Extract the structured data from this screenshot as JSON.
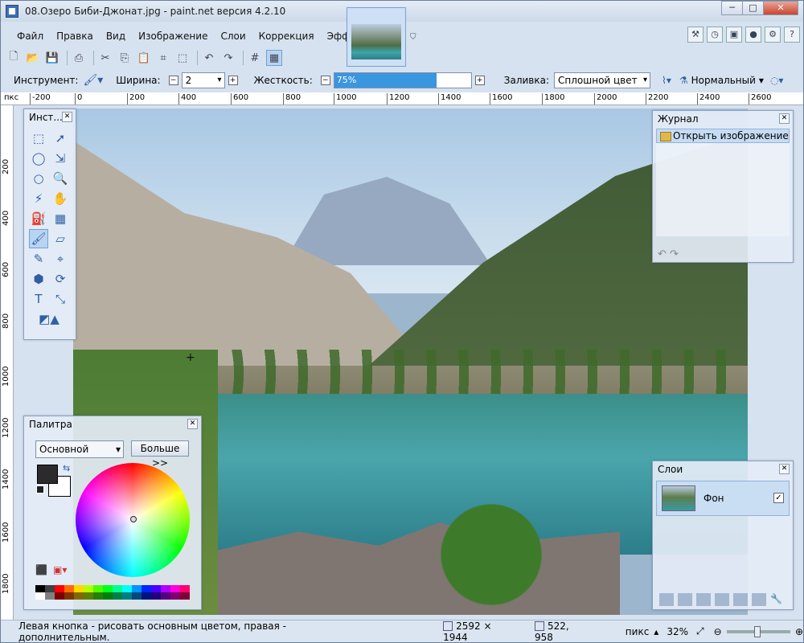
{
  "window": {
    "title": "08.Озеро Биби-Джонат.jpg - paint.net версия 4.2.10",
    "buttons": [
      "─",
      "□",
      "✕"
    ]
  },
  "menu": [
    "Файл",
    "Правка",
    "Вид",
    "Изображение",
    "Слои",
    "Коррекция",
    "Эффекты"
  ],
  "toolbar_icons": [
    "new-icon",
    "open-icon",
    "save-icon",
    "print-icon",
    "cut-icon",
    "copy-icon",
    "paste-icon",
    "crop-icon",
    "deselect-icon",
    "undo-icon",
    "redo-icon",
    "grid-icon",
    "ruler-icon"
  ],
  "options": {
    "tool_label": "Инструмент:",
    "width_label": "Ширина:",
    "width_value": "2",
    "hardness_label": "Жесткость:",
    "hardness_value": "75%",
    "hardness_fraction": 0.75,
    "fill_label": "Заливка:",
    "fill_value": "Сплошной цвет",
    "blend_value": "Нормальный"
  },
  "ruler": {
    "unit": "пкс",
    "h_ticks": [
      "-200",
      "0",
      "200",
      "400",
      "600",
      "800",
      "1000",
      "1200",
      "1400",
      "1600",
      "1800",
      "2000",
      "2200",
      "2400",
      "2600"
    ],
    "v_ticks": [
      "200",
      "400",
      "600",
      "800",
      "1000",
      "1200",
      "1400",
      "1600",
      "1800"
    ]
  },
  "tools_panel": {
    "title": "Инст..."
  },
  "journal": {
    "title": "Журнал",
    "item": "Открыть изображение"
  },
  "palette": {
    "title": "Палитра",
    "select": "Основной",
    "more_button": "Больше >>"
  },
  "layers": {
    "title": "Слои",
    "layer_name": "Фон"
  },
  "status": {
    "hint": "Левая кнопка - рисовать основным цветом, правая - дополнительным.",
    "image_size": "2592 × 1944",
    "cursor_pos": "522, 958",
    "unit": "пикс",
    "zoom": "32%"
  }
}
